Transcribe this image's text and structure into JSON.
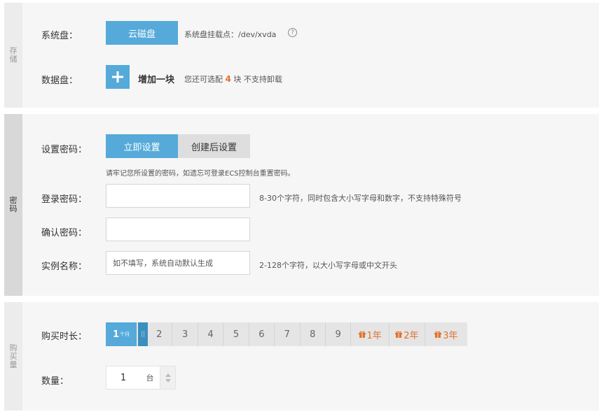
{
  "storage": {
    "side_label": [
      "存",
      "储"
    ],
    "system_disk_label": "系统盘：",
    "system_disk_type": "云磁盘",
    "mount_point_text": "系统盘挂载点：/dev/xvda",
    "data_disk_label": "数据盘：",
    "add_one_label": "增加一块",
    "remaining_prefix": "您还可选配",
    "remaining_count": "4",
    "remaining_suffix": "块 不支持卸载"
  },
  "password": {
    "side_label": [
      "密",
      "码"
    ],
    "set_password_label": "设置密码：",
    "set_now_label": "立即设置",
    "set_after_label": "创建后设置",
    "reminder": "请牢记您所设置的密码，如遗忘可登录ECS控制台重置密码。",
    "login_password_label": "登录密码：",
    "login_password_value": "",
    "login_password_hint": "8-30个字符，同时包含大小写字母和数字，不支持特殊符号",
    "confirm_password_label": "确认密码：",
    "confirm_password_value": "",
    "instance_name_label": "实例名称：",
    "instance_name_placeholder": "如不填写，系统自动默认生成",
    "instance_name_hint": "2-128个字符，以大小写字母或中文开头"
  },
  "purchase": {
    "side_label": [
      "购",
      "买",
      "量"
    ],
    "duration_label": "购买时长：",
    "duration_selected": "1",
    "duration_unit": "个月",
    "months": [
      "2",
      "3",
      "4",
      "5",
      "6",
      "7",
      "8",
      "9"
    ],
    "years": [
      "1年",
      "2年",
      "3年"
    ],
    "quantity_label": "数量：",
    "quantity_value": "1",
    "quantity_unit": "台"
  },
  "colors": {
    "accent": "#55aad9",
    "highlight": "#e0712d"
  }
}
